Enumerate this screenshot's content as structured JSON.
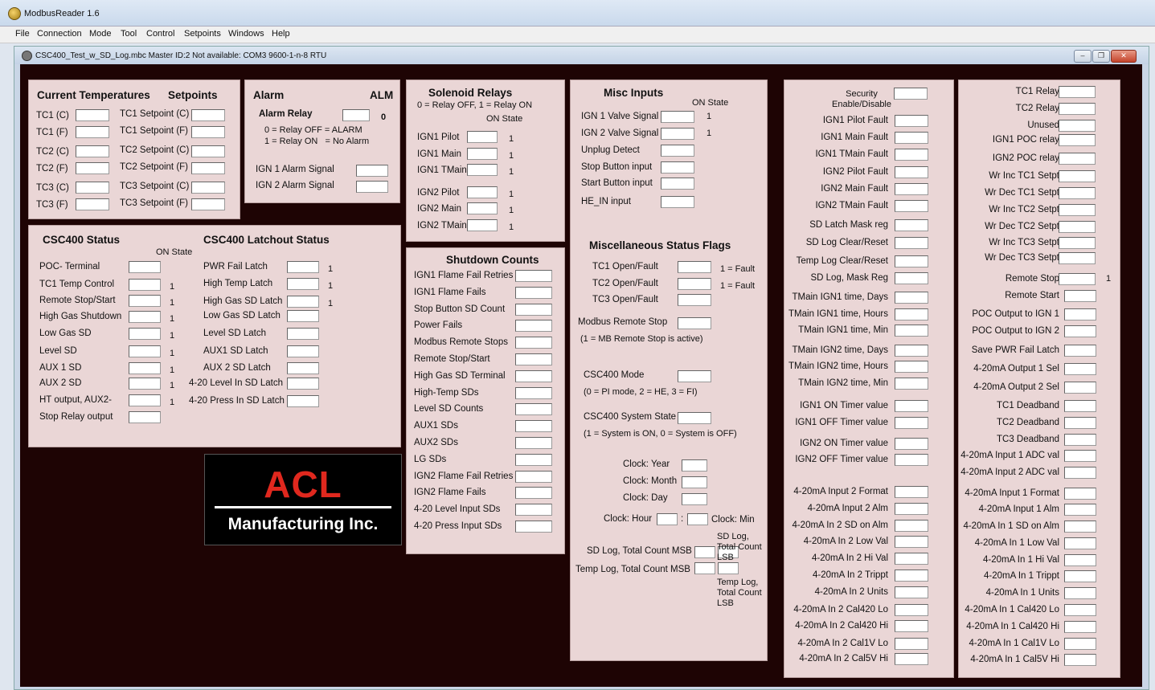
{
  "app": {
    "title": "ModbusReader 1.6"
  },
  "menu": [
    "File",
    "Connection",
    "Mode",
    "Tool",
    "Control",
    "Setpoints",
    "Windows",
    "Help"
  ],
  "document": {
    "title": "CSC400_Test_w_SD_Log.mbc  Master ID:2  Not available: COM3  9600-1-n-8 RTU"
  },
  "colors": {
    "workspace": "#1e0404",
    "panel": "#ead6d6",
    "logo_red": "#e0281e"
  },
  "temps": {
    "title": "Current Temperatures",
    "setpoints_title": "Setpoints",
    "left": [
      "TC1 (C)",
      "TC1 (F)",
      "TC2 (C)",
      "TC2 (F)",
      "TC3 (C)",
      "TC3 (F)"
    ],
    "right": [
      "TC1 Setpoint (C)",
      "TC1 Setpoint (F)",
      "TC2 Setpoint (C)",
      "TC2 Setpoint (F)",
      "TC3 Setpoint (C)",
      "TC3 Setpoint (F)"
    ]
  },
  "alarm": {
    "title": "Alarm",
    "alm": "ALM",
    "relay_label": "Alarm Relay",
    "relay_value": "0",
    "legend1": "0 = Relay OFF = ALARM",
    "legend2": "1 = Relay ON   = No Alarm",
    "signals": [
      "IGN 1 Alarm Signal",
      "IGN 2 Alarm Signal"
    ]
  },
  "solenoid": {
    "title": "Solenoid Relays",
    "legend": "0 = Relay OFF, 1 = Relay ON",
    "on_state": "ON State",
    "items": [
      {
        "label": "IGN1 Pilot",
        "value": "1"
      },
      {
        "label": "IGN1 Main",
        "value": "1"
      },
      {
        "label": "IGN1 TMain",
        "value": "1"
      },
      {
        "label": "IGN2 Pilot",
        "value": "1"
      },
      {
        "label": "IGN2 Main",
        "value": "1"
      },
      {
        "label": "IGN2 TMain",
        "value": "1"
      }
    ]
  },
  "misc": {
    "title": "Misc Inputs",
    "on_state": "ON State",
    "items": [
      {
        "label": "IGN 1 Valve Signal",
        "value": "1"
      },
      {
        "label": "IGN 2 Valve Signal",
        "value": "1"
      },
      {
        "label": "Unplug Detect",
        "value": ""
      },
      {
        "label": "Stop Button input",
        "value": ""
      },
      {
        "label": "Start Button input",
        "value": ""
      },
      {
        "label": "HE_IN input",
        "value": ""
      }
    ]
  },
  "status": {
    "title": "CSC400 Status",
    "latch_title": "CSC400 Latchout Status",
    "on_state": "ON State",
    "items": [
      {
        "label": "POC- Terminal",
        "value": ""
      },
      {
        "label": "TC1 Temp Control",
        "value": "1"
      },
      {
        "label": "Remote Stop/Start",
        "value": "1"
      },
      {
        "label": "High Gas Shutdown",
        "value": "1"
      },
      {
        "label": "Low Gas SD",
        "value": "1"
      },
      {
        "label": "Level SD",
        "value": "1"
      },
      {
        "label": "AUX 1 SD",
        "value": "1"
      },
      {
        "label": "AUX 2 SD",
        "value": "1"
      },
      {
        "label": "HT output, AUX2-",
        "value": "1"
      },
      {
        "label": "Stop Relay output",
        "value": ""
      }
    ],
    "latches": [
      {
        "label": "PWR Fail Latch",
        "value": "1"
      },
      {
        "label": "High Temp Latch",
        "value": "1"
      },
      {
        "label": "High Gas SD Latch",
        "value": "1"
      },
      {
        "label": "Low Gas SD Latch",
        "value": ""
      },
      {
        "label": "Level SD Latch",
        "value": ""
      },
      {
        "label": "AUX1 SD Latch",
        "value": ""
      },
      {
        "label": "AUX 2 SD Latch",
        "value": ""
      },
      {
        "label": "4-20 Level In SD Latch",
        "value": ""
      },
      {
        "label": "4-20 Press In SD Latch",
        "value": ""
      }
    ]
  },
  "shutdown": {
    "title": "Shutdown Counts",
    "items": [
      "IGN1 Flame Fail Retries",
      "IGN1 Flame Fails",
      "Stop Button SD Count",
      "Power Fails",
      "Modbus Remote Stops",
      "Remote Stop/Start",
      "High Gas SD Terminal",
      "High-Temp SDs",
      "Level SD Counts",
      "AUX1 SDs",
      "AUX2 SDs",
      "LG SDs",
      "IGN2 Flame Fail Retries",
      "IGN2 Flame Fails",
      "4-20 Level Input SDs",
      "4-20 Press Input SDs"
    ]
  },
  "flags": {
    "title": "Miscellaneous Status Flags",
    "faults": [
      {
        "label": "TC1 Open/Fault",
        "value": "1 = Fault"
      },
      {
        "label": "TC2 Open/Fault",
        "value": "1 = Fault"
      },
      {
        "label": "TC3 Open/Fault",
        "value": ""
      }
    ],
    "modbus_stop": "Modbus Remote Stop",
    "modbus_note": "(1 = MB Remote Stop is active)",
    "mode_label": "CSC400 Mode",
    "mode_note": "(0 = PI mode, 2 = HE, 3 = FI)",
    "state_label": "CSC400 System State",
    "state_note": "(1 = System is ON, 0 = System is OFF)",
    "clock_year": "Clock: Year",
    "clock_month": "Clock: Month",
    "clock_day": "Clock: Day",
    "clock_hour": "Clock: Hour",
    "clock_sep": ":",
    "clock_min": "Clock: Min",
    "sdlog_msb": "SD Log, Total Count MSB",
    "templog_msb": "Temp Log, Total Count MSB",
    "sdlog_lsb": "SD Log, Total Count LSB",
    "templog_lsb": "Temp Log, Total Count LSB"
  },
  "column3": {
    "security": "Security Enable/Disable",
    "items": [
      "IGN1 Pilot Fault",
      "IGN1 Main Fault",
      "IGN1 TMain Fault",
      "IGN2 Pilot Fault",
      "IGN2 Main Fault",
      "IGN2 TMain Fault",
      "SD Latch Mask reg",
      "SD Log Clear/Reset",
      "Temp Log Clear/Reset",
      "SD Log, Mask Reg",
      "TMain IGN1 time, Days",
      "TMain IGN1 time, Hours",
      "TMain IGN1 time, Min",
      "TMain IGN2 time, Days",
      "TMain IGN2 time, Hours",
      "TMain IGN2 time, Min",
      "IGN1 ON Timer value",
      "IGN1 OFF Timer value",
      "IGN2 ON Timer value",
      "IGN2 OFF Timer value",
      "4-20mA Input 2 Format",
      "4-20mA Input 2 Alm",
      "4-20mA In 2 SD on Alm",
      "4-20mA In 2 Low Val",
      "4-20mA In 2 Hi Val",
      "4-20mA In 2 Trippt",
      "4-20mA In 2 Units",
      "4-20mA In 2 Cal420 Lo",
      "4-20mA In 2 Cal420 Hi",
      "4-20mA In 2 Cal1V Lo",
      "4-20mA In 2 Cal5V Hi"
    ]
  },
  "column4": {
    "items": [
      {
        "label": "TC1 Relay",
        "value": ""
      },
      {
        "label": "TC2 Relay",
        "value": ""
      },
      {
        "label": "Unused",
        "value": ""
      },
      {
        "label": "IGN1 POC relay",
        "value": ""
      },
      {
        "label": "IGN2 POC relay",
        "value": ""
      },
      {
        "label": "Wr Inc TC1 Setpt",
        "value": ""
      },
      {
        "label": "Wr Dec TC1 Setpt",
        "value": ""
      },
      {
        "label": "Wr Inc TC2 Setpt",
        "value": ""
      },
      {
        "label": "Wr Dec TC2 Setpt",
        "value": ""
      },
      {
        "label": "Wr Inc TC3 Setpt",
        "value": ""
      },
      {
        "label": "Wr Dec TC3 Setpt",
        "value": ""
      },
      {
        "label": "Remote Stop",
        "value": "1"
      },
      {
        "label": "Remote Start",
        "value": ""
      },
      {
        "label": "POC Output to IGN 1",
        "value": ""
      },
      {
        "label": "POC Output to IGN 2",
        "value": ""
      },
      {
        "label": "Save PWR Fail Latch",
        "value": ""
      },
      {
        "label": "4-20mA Output 1 Sel",
        "value": ""
      },
      {
        "label": "4-20mA Output 2 Sel",
        "value": ""
      },
      {
        "label": "TC1 Deadband",
        "value": ""
      },
      {
        "label": "TC2 Deadband",
        "value": ""
      },
      {
        "label": "TC3 Deadband",
        "value": ""
      },
      {
        "label": "4-20mA Input 1 ADC val",
        "value": ""
      },
      {
        "label": "4-20mA Input 2 ADC val",
        "value": ""
      },
      {
        "label": "4-20mA Input 1 Format",
        "value": ""
      },
      {
        "label": "4-20mA Input 1 Alm",
        "value": ""
      },
      {
        "label": "4-20mA In 1 SD on Alm",
        "value": ""
      },
      {
        "label": "4-20mA In 1 Low Val",
        "value": ""
      },
      {
        "label": "4-20mA In 1 Hi Val",
        "value": ""
      },
      {
        "label": "4-20mA In 1 Trippt",
        "value": ""
      },
      {
        "label": "4-20mA In 1 Units",
        "value": ""
      },
      {
        "label": "4-20mA In 1 Cal420 Lo",
        "value": ""
      },
      {
        "label": "4-20mA In 1 Cal420 Hi",
        "value": ""
      },
      {
        "label": "4-20mA In 1 Cal1V Lo",
        "value": ""
      },
      {
        "label": "4-20mA In 1 Cal5V Hi",
        "value": ""
      }
    ]
  },
  "logo": {
    "line1": "ACL",
    "line2": "Manufacturing Inc."
  }
}
